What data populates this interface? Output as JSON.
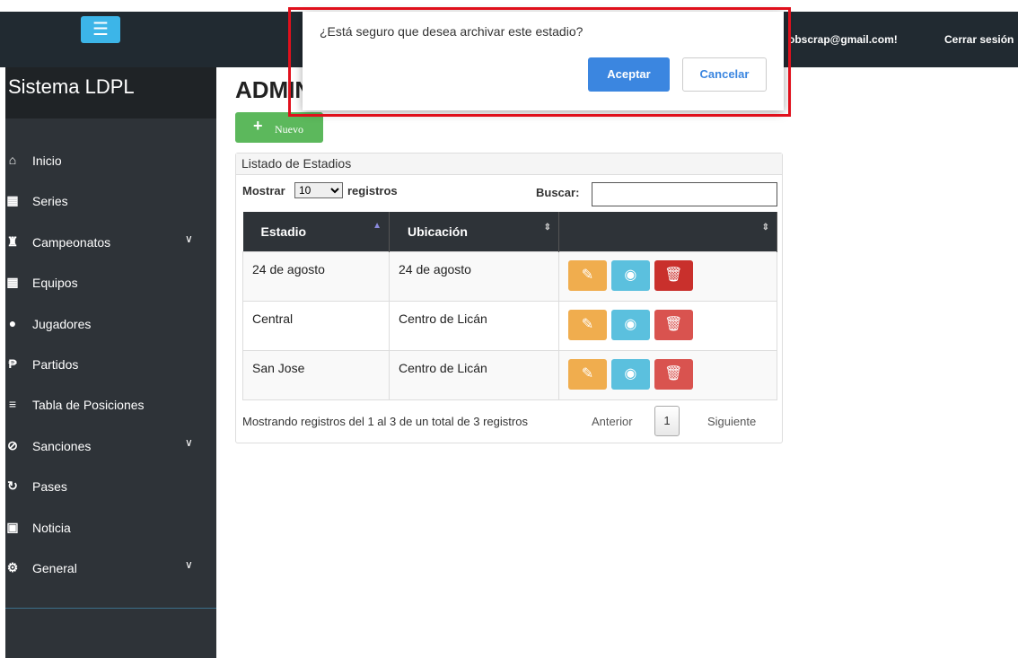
{
  "topbar": {
    "menu_icon": "hamburger-icon",
    "email": "obscrap@gmail.com!",
    "logout": "Cerrar sesión"
  },
  "sidebar": {
    "brand": "Sistema LDPL",
    "items": [
      {
        "icon": "home-icon",
        "label": "Inicio",
        "has_submenu": false
      },
      {
        "icon": "grid-icon",
        "label": "Series",
        "has_submenu": false
      },
      {
        "icon": "trophy-icon",
        "label": "Campeonatos",
        "has_submenu": true
      },
      {
        "icon": "grid-icon",
        "label": "Equipos",
        "has_submenu": false
      },
      {
        "icon": "user-icon",
        "label": "Jugadores",
        "has_submenu": false
      },
      {
        "icon": "flag-icon",
        "label": "Partidos",
        "has_submenu": false
      },
      {
        "icon": "list-icon",
        "label": "Tabla de Posiciones",
        "has_submenu": false
      },
      {
        "icon": "ban-icon",
        "label": "Sanciones",
        "has_submenu": true
      },
      {
        "icon": "refresh-icon",
        "label": "Pases",
        "has_submenu": false
      },
      {
        "icon": "picture-icon",
        "label": "Noticia",
        "has_submenu": false
      },
      {
        "icon": "gear-icon",
        "label": "General",
        "has_submenu": true
      }
    ]
  },
  "main": {
    "title": "ADMIN",
    "new_button": "Nuevo",
    "panel_title": "Listado de Estadios",
    "length": {
      "prefix": "Mostrar",
      "value": "10",
      "suffix": "registros"
    },
    "search_label": "Buscar:",
    "table": {
      "headers": [
        "Estadio",
        "Ubicación",
        ""
      ],
      "rows": [
        {
          "estadio": "24 de agosto",
          "ubicacion": "24 de agosto"
        },
        {
          "estadio": "Central",
          "ubicacion": "Centro de Licán"
        },
        {
          "estadio": "San Jose",
          "ubicacion": "Centro de Licán"
        }
      ]
    },
    "info": "Mostrando registros del 1 al 3 de un total de 3 registros",
    "pagination": {
      "prev": "Anterior",
      "page": "1",
      "next": "Siguiente"
    }
  },
  "dialog": {
    "message": "¿Está seguro que desea archivar este estadio?",
    "ok": "Aceptar",
    "cancel": "Cancelar"
  },
  "colors": {
    "topbar": "#212a31",
    "sidebar": "#2e3338",
    "primary": "#3b86e0",
    "success": "#5cb85c",
    "warning": "#f0ad4e",
    "info": "#5bc0de",
    "danger": "#d9534f",
    "highlight": "#e0101c"
  }
}
